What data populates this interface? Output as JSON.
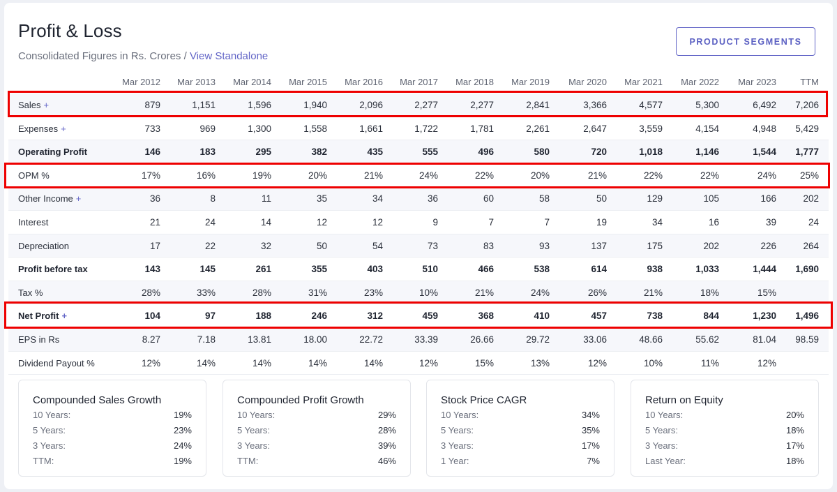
{
  "page": {
    "title": "Profit & Loss",
    "subtitle": "Consolidated Figures in Rs. Crores / ",
    "subtitle_link": "View Standalone",
    "segments_button": "PRODUCT SEGMENTS"
  },
  "columns": [
    "Mar 2012",
    "Mar 2013",
    "Mar 2014",
    "Mar 2015",
    "Mar 2016",
    "Mar 2017",
    "Mar 2018",
    "Mar 2019",
    "Mar 2020",
    "Mar 2021",
    "Mar 2022",
    "Mar 2023",
    "TTM"
  ],
  "rows": [
    {
      "label": "Sales",
      "plus": "+",
      "bold": false,
      "values": [
        "879",
        "1,151",
        "1,596",
        "1,940",
        "2,096",
        "2,277",
        "2,277",
        "2,841",
        "3,366",
        "4,577",
        "5,300",
        "6,492",
        "7,206"
      ]
    },
    {
      "label": "Expenses",
      "plus": "+",
      "bold": false,
      "values": [
        "733",
        "969",
        "1,300",
        "1,558",
        "1,661",
        "1,722",
        "1,781",
        "2,261",
        "2,647",
        "3,559",
        "4,154",
        "4,948",
        "5,429"
      ]
    },
    {
      "label": "Operating Profit",
      "plus": "",
      "bold": true,
      "values": [
        "146",
        "183",
        "295",
        "382",
        "435",
        "555",
        "496",
        "580",
        "720",
        "1,018",
        "1,146",
        "1,544",
        "1,777"
      ]
    },
    {
      "label": "OPM %",
      "plus": "",
      "bold": false,
      "values": [
        "17%",
        "16%",
        "19%",
        "20%",
        "21%",
        "24%",
        "22%",
        "20%",
        "21%",
        "22%",
        "22%",
        "24%",
        "25%"
      ]
    },
    {
      "label": "Other Income",
      "plus": "+",
      "bold": false,
      "values": [
        "36",
        "8",
        "11",
        "35",
        "34",
        "36",
        "60",
        "58",
        "50",
        "129",
        "105",
        "166",
        "202"
      ]
    },
    {
      "label": "Interest",
      "plus": "",
      "bold": false,
      "values": [
        "21",
        "24",
        "14",
        "12",
        "12",
        "9",
        "7",
        "7",
        "19",
        "34",
        "16",
        "39",
        "24"
      ]
    },
    {
      "label": "Depreciation",
      "plus": "",
      "bold": false,
      "values": [
        "17",
        "22",
        "32",
        "50",
        "54",
        "73",
        "83",
        "93",
        "137",
        "175",
        "202",
        "226",
        "264"
      ]
    },
    {
      "label": "Profit before tax",
      "plus": "",
      "bold": true,
      "values": [
        "143",
        "145",
        "261",
        "355",
        "403",
        "510",
        "466",
        "538",
        "614",
        "938",
        "1,033",
        "1,444",
        "1,690"
      ]
    },
    {
      "label": "Tax %",
      "plus": "",
      "bold": false,
      "values": [
        "28%",
        "33%",
        "28%",
        "31%",
        "23%",
        "10%",
        "21%",
        "24%",
        "26%",
        "21%",
        "18%",
        "15%",
        ""
      ]
    },
    {
      "label": "Net Profit",
      "plus": "+",
      "bold": true,
      "values": [
        "104",
        "97",
        "188",
        "246",
        "312",
        "459",
        "368",
        "410",
        "457",
        "738",
        "844",
        "1,230",
        "1,496"
      ]
    },
    {
      "label": "EPS in Rs",
      "plus": "",
      "bold": false,
      "values": [
        "8.27",
        "7.18",
        "13.81",
        "18.00",
        "22.72",
        "33.39",
        "26.66",
        "29.72",
        "33.06",
        "48.66",
        "55.62",
        "81.04",
        "98.59"
      ]
    },
    {
      "label": "Dividend Payout %",
      "plus": "",
      "bold": false,
      "values": [
        "12%",
        "14%",
        "14%",
        "14%",
        "14%",
        "12%",
        "15%",
        "13%",
        "12%",
        "10%",
        "11%",
        "12%",
        ""
      ]
    }
  ],
  "growth_boxes": [
    {
      "title": "Compounded Sales Growth",
      "items": [
        {
          "k": "10 Years:",
          "v": "19%"
        },
        {
          "k": "5 Years:",
          "v": "23%"
        },
        {
          "k": "3 Years:",
          "v": "24%"
        },
        {
          "k": "TTM:",
          "v": "19%"
        }
      ]
    },
    {
      "title": "Compounded Profit Growth",
      "items": [
        {
          "k": "10 Years:",
          "v": "29%"
        },
        {
          "k": "5 Years:",
          "v": "28%"
        },
        {
          "k": "3 Years:",
          "v": "39%"
        },
        {
          "k": "TTM:",
          "v": "46%"
        }
      ]
    },
    {
      "title": "Stock Price CAGR",
      "items": [
        {
          "k": "10 Years:",
          "v": "34%"
        },
        {
          "k": "5 Years:",
          "v": "35%"
        },
        {
          "k": "3 Years:",
          "v": "17%"
        },
        {
          "k": "1 Year:",
          "v": "7%"
        }
      ]
    },
    {
      "title": "Return on Equity",
      "items": [
        {
          "k": "10 Years:",
          "v": "20%"
        },
        {
          "k": "5 Years:",
          "v": "18%"
        },
        {
          "k": "3 Years:",
          "v": "17%"
        },
        {
          "k": "Last Year:",
          "v": "18%"
        }
      ]
    }
  ],
  "colors": {
    "accent": "#6366c7",
    "highlight": "#ee0000"
  }
}
